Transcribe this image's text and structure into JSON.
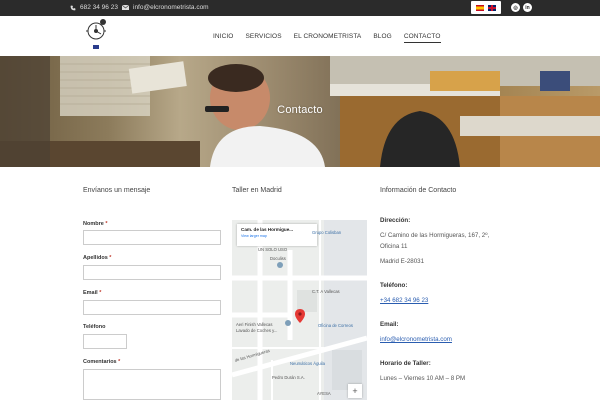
{
  "topbar": {
    "phone": "682 34 96 23",
    "email": "info@elcronometrista.com",
    "languages": [
      "es",
      "en"
    ],
    "social": [
      "instagram-icon",
      "linkedin-icon"
    ]
  },
  "nav": {
    "items": [
      "INICIO",
      "SERVICIOS",
      "EL CRONOMETRISTA",
      "BLOG",
      "CONTACTO"
    ],
    "active": "CONTACTO"
  },
  "hero": {
    "title": "Contacto"
  },
  "form": {
    "title": "Envíanos un mensaje",
    "fields": {
      "nombre": "Nombre",
      "apellidos": "Apellidos",
      "email": "Email",
      "telefono": "Teléfono",
      "comentarios": "Comentarios"
    },
    "required_mark": "*"
  },
  "map": {
    "title": "Taller en Madrid",
    "card_title": "Cam. de las Hormigue...",
    "card_link": "View larger map",
    "labels": [
      "Grupo Colisban",
      "UN SOLO USO",
      "Doculiss",
      "C.T. A Vallecas",
      "Aeri Finish Vallecas",
      "Lavado de Coches y...",
      "Oficina de Correos",
      "Neumáticos Águila",
      "Pedro Durán S.A.",
      "AYESA",
      "de las Hormigueras"
    ],
    "zoom_in": "+"
  },
  "info": {
    "title": "Información de Contacto",
    "address_label": "Dirección",
    "address_line1": "C/ Camino de las Hormigueras, 167, 2º,",
    "address_line2": "Oficina 11",
    "address_line3": "Madrid E-28031",
    "phone_label": "Teléfono",
    "phone": "+34 682 34 96 23",
    "email_label": "Email",
    "email": "info@elcronometrista.com",
    "hours_label": "Horario de Taller",
    "hours": "Lunes – Viernes 10 AM – 8 PM"
  },
  "colors": {
    "topbar": "#2b2b2b",
    "accent_red": "#c0392b",
    "link": "#2a5db0"
  }
}
